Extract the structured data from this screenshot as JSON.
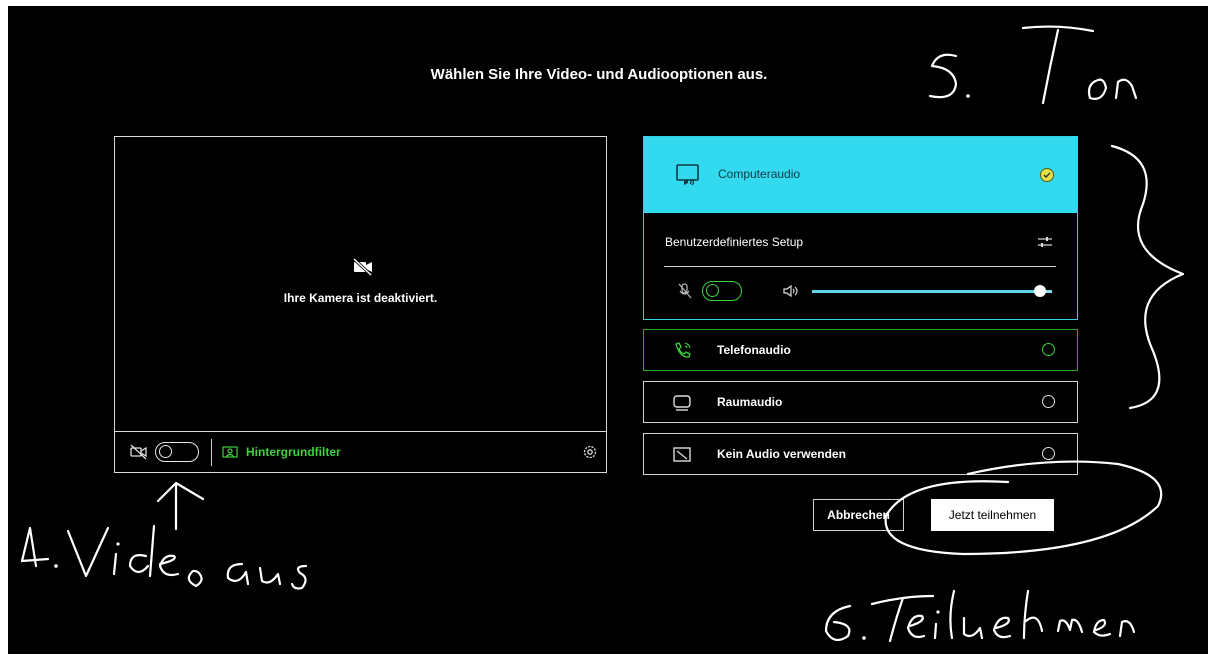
{
  "title": "Wählen Sie Ihre Video- und Audiooptionen aus.",
  "video": {
    "camera_off_text": "Ihre Kamera ist deaktiviert.",
    "background_filter_label": "Hintergrundfilter",
    "camera_toggle_on": false
  },
  "audio": {
    "computer": {
      "label": "Computeraudio",
      "selected": true,
      "custom_setup_label": "Benutzerdefiniertes Setup",
      "mic_toggle_on": false,
      "volume_level": 0.95
    },
    "phone": {
      "label": "Telefonaudio",
      "selected": false
    },
    "room": {
      "label": "Raumaudio",
      "selected": false
    },
    "none": {
      "label": "Kein Audio verwenden",
      "selected": false
    }
  },
  "buttons": {
    "cancel": "Abbrechen",
    "join": "Jetzt teilnehmen"
  },
  "annotations": {
    "video_note": "4. Video aus",
    "sound_note": "5. Ton",
    "join_note": "6. Teilnehmen"
  },
  "colors": {
    "accent_cyan": "#33d9ee",
    "accent_green": "#3dd13d",
    "check_yellow": "#e6e04a"
  }
}
